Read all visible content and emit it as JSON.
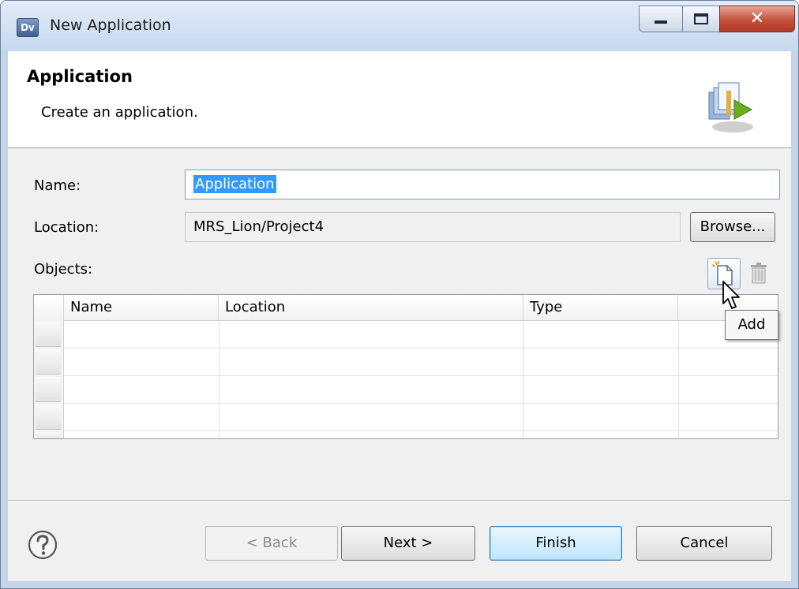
{
  "window": {
    "title": "New Application",
    "app_icon_text": "Dv"
  },
  "banner": {
    "title": "Application",
    "subtitle": "Create an application."
  },
  "form": {
    "name_label": "Name:",
    "name_value": "Application",
    "location_label": "Location:",
    "location_value": "MRS_Lion/Project4",
    "browse_label": "Browse...",
    "objects_label": "Objects:"
  },
  "objects_table": {
    "columns": [
      "Name",
      "Location",
      "Type"
    ],
    "rows": []
  },
  "tooltip": {
    "text": "Add"
  },
  "buttons": {
    "back": "< Back",
    "next": "Next >",
    "finish": "Finish",
    "cancel": "Cancel"
  }
}
